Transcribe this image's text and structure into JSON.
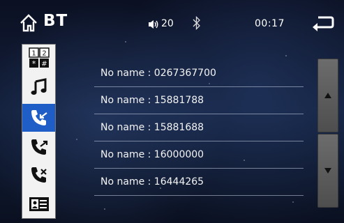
{
  "header": {
    "title": "BT",
    "volume": "20",
    "time": "00:17",
    "icons": [
      "home-icon",
      "volume-icon",
      "bluetooth-icon",
      "back-icon"
    ]
  },
  "sidebar": {
    "items": [
      {
        "name": "dialpad",
        "icon": "dialpad-icon",
        "labels": [
          "1",
          "2",
          "*",
          "#"
        ]
      },
      {
        "name": "music",
        "icon": "music-icon"
      },
      {
        "name": "received-calls",
        "icon": "incoming-call-icon",
        "active": true
      },
      {
        "name": "dialed-calls",
        "icon": "outgoing-call-icon"
      },
      {
        "name": "missed-calls",
        "icon": "missed-call-icon"
      },
      {
        "name": "contacts",
        "icon": "contacts-icon"
      }
    ]
  },
  "call_list": [
    {
      "entry": "No name : 0267367700"
    },
    {
      "entry": "No name : 15881788"
    },
    {
      "entry": "No name : 15881688"
    },
    {
      "entry": "No name : 16000000"
    },
    {
      "entry": "No name : 16444265"
    }
  ],
  "colors": {
    "active": "#1f5ec7",
    "sidebar_bg": "#f2f2f2"
  }
}
